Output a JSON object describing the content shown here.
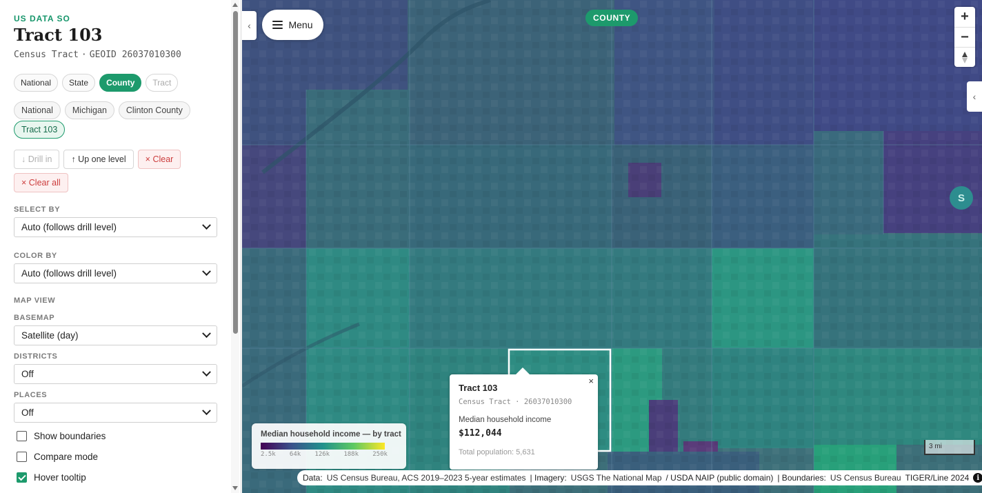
{
  "sidebar": {
    "brand": "US DATA SO",
    "title": "Tract 103",
    "subtitle_type": "Census Tract",
    "subtitle_sep": "·",
    "subtitle_geoid": "GEOID 26037010300",
    "level_pills": [
      {
        "label": "National",
        "state": "normal"
      },
      {
        "label": "State",
        "state": "normal"
      },
      {
        "label": "County",
        "state": "active"
      },
      {
        "label": "Tract",
        "state": "disabled"
      }
    ],
    "breadcrumbs": [
      "National",
      "Michigan",
      "Clinton County",
      "Tract 103"
    ],
    "actions": {
      "drill_in": "↓ Drill in",
      "up_one_level": "↑ Up one level",
      "clear": "× Clear",
      "clear_all": "× Clear all"
    },
    "select_by": {
      "label": "SELECT BY",
      "value": "Auto (follows drill level)"
    },
    "color_by": {
      "label": "COLOR BY",
      "value": "Auto (follows drill level)"
    },
    "map_view_label": "MAP VIEW",
    "basemap": {
      "label": "BASEMAP",
      "value": "Satellite (day)"
    },
    "districts": {
      "label": "DISTRICTS",
      "value": "Off"
    },
    "places": {
      "label": "PLACES",
      "value": "Off"
    },
    "checkboxes": [
      {
        "label": "Show boundaries",
        "checked": false
      },
      {
        "label": "Compare mode",
        "checked": false
      },
      {
        "label": "Hover tooltip",
        "checked": true
      }
    ]
  },
  "map": {
    "collapse_icon": "‹",
    "menu_label": "Menu",
    "level_badge": "COUNTY",
    "zoom_in": "+",
    "zoom_out": "−",
    "right_tab_icon": "‹",
    "user_initial": "S",
    "legend": {
      "title": "Median household income — by tract",
      "ticks": [
        "2.5k",
        "64k",
        "126k",
        "188k",
        "250k"
      ]
    },
    "popup": {
      "close": "×",
      "title": "Tract 103",
      "subtitle": "Census Tract · 26037010300",
      "metric_label": "Median household income",
      "metric_value": "$112,044",
      "population": "Total population: 5,631"
    },
    "scale_label": "3 mi",
    "attribution": {
      "data_prefix": "Data:",
      "data_source": "US Census Bureau, ACS 2019–2023 5-year estimates",
      "imagery_prefix": "| Imagery:",
      "imagery_source": "USGS The National Map",
      "naip": "/ USDA NAIP (public domain)",
      "boundaries_prefix": "| Boundaries:",
      "boundaries_source": "US Census Bureau",
      "tiger": "TIGER/Line 2024",
      "info_icon": "i"
    },
    "colors": {
      "accent": "#1d9a6c",
      "tract_fill_dark": "#3b3f7a",
      "tract_fill_mid": "#2b7b7c",
      "tract_fill_light": "#2e9b80"
    }
  }
}
